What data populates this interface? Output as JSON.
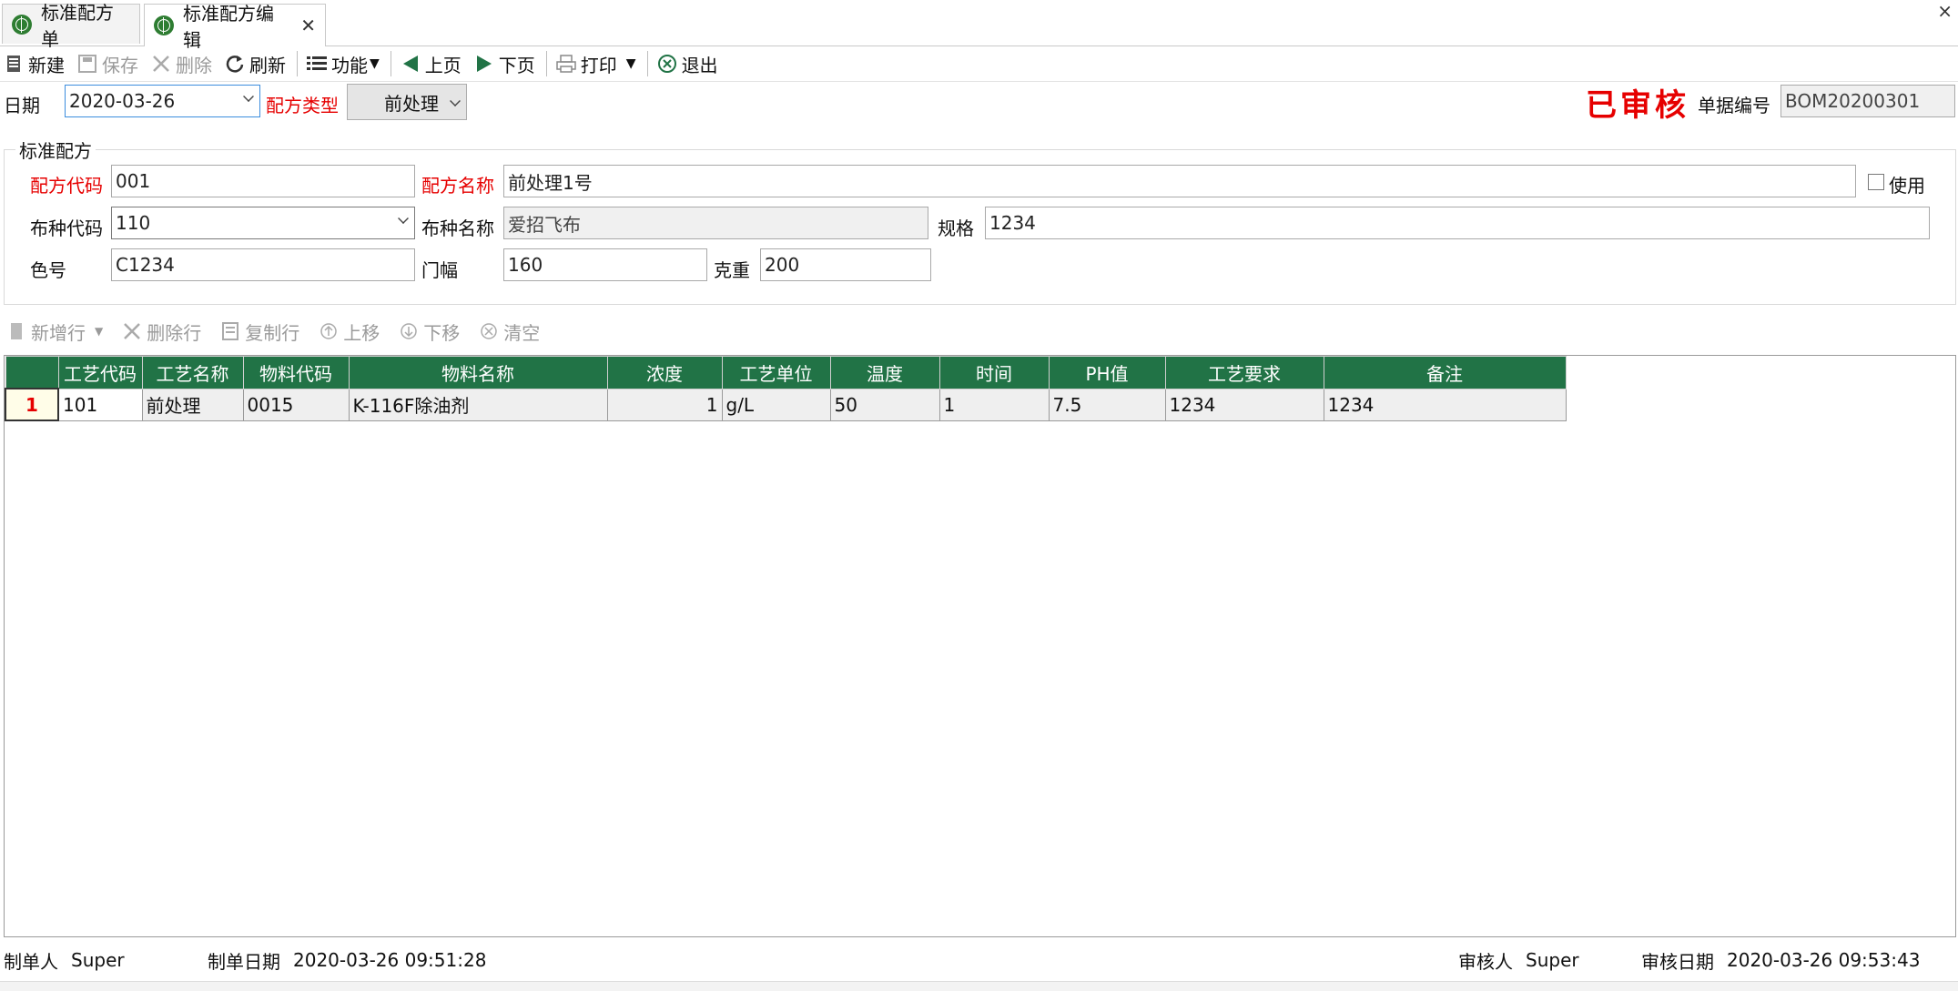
{
  "tabs": [
    {
      "label": "标准配方单"
    },
    {
      "label": "标准配方编辑",
      "close": "✕"
    }
  ],
  "window_close": "×",
  "toolbar": {
    "new": "新建",
    "save": "保存",
    "delete": "删除",
    "refresh": "刷新",
    "function": "功能",
    "prev": "上页",
    "next": "下页",
    "print": "打印",
    "exit": "退出"
  },
  "header": {
    "date_label": "日期",
    "date_value": "2020-03-26",
    "type_label": "配方类型",
    "type_value": "前处理",
    "status_stamp": "已审核",
    "doc_no_label": "单据编号",
    "doc_no_value": "BOM20200301"
  },
  "group": {
    "title": "标准配方",
    "code_label": "配方代码",
    "code_value": "001",
    "name_label": "配方名称",
    "name_value": "前处理1号",
    "use_label": "使用",
    "fabric_code_label": "布种代码",
    "fabric_code_value": "110",
    "fabric_name_label": "布种名称",
    "fabric_name_value": "爱招飞布",
    "spec_label": "规格",
    "spec_value": "1234",
    "color_label": "色号",
    "color_value": "C1234",
    "width_label": "门幅",
    "width_value": "160",
    "weight_label": "克重",
    "weight_value": "200"
  },
  "grid_toolbar": {
    "add_row": "新增行",
    "delete_row": "删除行",
    "copy_row": "复制行",
    "move_up": "上移",
    "move_down": "下移",
    "clear": "清空"
  },
  "grid": {
    "columns": [
      "",
      "工艺代码",
      "工艺名称",
      "物料代码",
      "物料名称",
      "浓度",
      "工艺单位",
      "温度",
      "时间",
      "PH值",
      "工艺要求",
      "备注"
    ],
    "rows": [
      [
        "1",
        "101",
        "前处理",
        "0015",
        "K-116F除油剂",
        "1",
        "g/L",
        "50",
        "1",
        "7.5",
        "1234",
        "1234"
      ]
    ]
  },
  "footer": {
    "creator_label": "制单人",
    "creator_value": "Super",
    "create_date_label": "制单日期",
    "create_date_value": "2020-03-26 09:51:28",
    "reviewer_label": "审核人",
    "reviewer_value": "Super",
    "review_date_label": "审核日期",
    "review_date_value": "2020-03-26 09:53:43"
  },
  "colors": {
    "grid_header": "#217346",
    "required_label": "#e60000",
    "stamp": "#e60000",
    "accent": "#3c8dde"
  },
  "icons": [
    "globe-icon",
    "new-doc-icon",
    "save-icon",
    "delete-icon",
    "refresh-icon",
    "list-icon",
    "prev-icon",
    "next-icon",
    "printer-icon",
    "exit-icon"
  ]
}
